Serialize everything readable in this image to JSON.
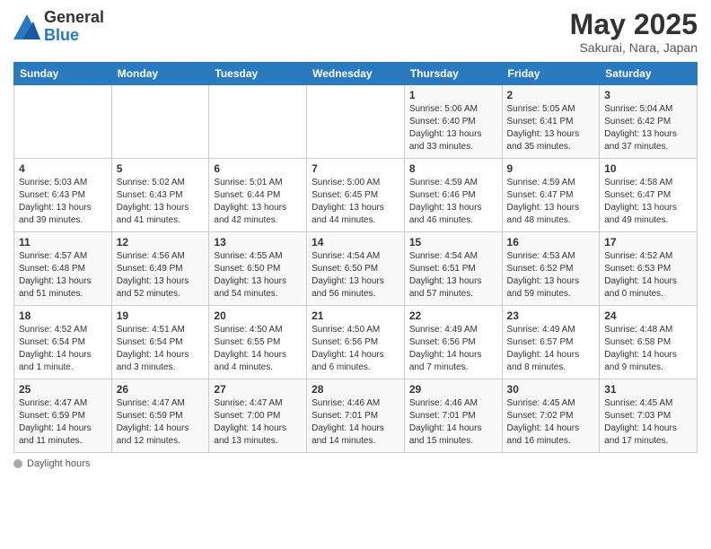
{
  "header": {
    "logo_general": "General",
    "logo_blue": "Blue",
    "month_year": "May 2025",
    "location": "Sakurai, Nara, Japan"
  },
  "weekdays": [
    "Sunday",
    "Monday",
    "Tuesday",
    "Wednesday",
    "Thursday",
    "Friday",
    "Saturday"
  ],
  "weeks": [
    [
      {
        "day": "",
        "info": ""
      },
      {
        "day": "",
        "info": ""
      },
      {
        "day": "",
        "info": ""
      },
      {
        "day": "",
        "info": ""
      },
      {
        "day": "1",
        "info": "Sunrise: 5:06 AM\nSunset: 6:40 PM\nDaylight: 13 hours\nand 33 minutes."
      },
      {
        "day": "2",
        "info": "Sunrise: 5:05 AM\nSunset: 6:41 PM\nDaylight: 13 hours\nand 35 minutes."
      },
      {
        "day": "3",
        "info": "Sunrise: 5:04 AM\nSunset: 6:42 PM\nDaylight: 13 hours\nand 37 minutes."
      }
    ],
    [
      {
        "day": "4",
        "info": "Sunrise: 5:03 AM\nSunset: 6:43 PM\nDaylight: 13 hours\nand 39 minutes."
      },
      {
        "day": "5",
        "info": "Sunrise: 5:02 AM\nSunset: 6:43 PM\nDaylight: 13 hours\nand 41 minutes."
      },
      {
        "day": "6",
        "info": "Sunrise: 5:01 AM\nSunset: 6:44 PM\nDaylight: 13 hours\nand 42 minutes."
      },
      {
        "day": "7",
        "info": "Sunrise: 5:00 AM\nSunset: 6:45 PM\nDaylight: 13 hours\nand 44 minutes."
      },
      {
        "day": "8",
        "info": "Sunrise: 4:59 AM\nSunset: 6:46 PM\nDaylight: 13 hours\nand 46 minutes."
      },
      {
        "day": "9",
        "info": "Sunrise: 4:59 AM\nSunset: 6:47 PM\nDaylight: 13 hours\nand 48 minutes."
      },
      {
        "day": "10",
        "info": "Sunrise: 4:58 AM\nSunset: 6:47 PM\nDaylight: 13 hours\nand 49 minutes."
      }
    ],
    [
      {
        "day": "11",
        "info": "Sunrise: 4:57 AM\nSunset: 6:48 PM\nDaylight: 13 hours\nand 51 minutes."
      },
      {
        "day": "12",
        "info": "Sunrise: 4:56 AM\nSunset: 6:49 PM\nDaylight: 13 hours\nand 52 minutes."
      },
      {
        "day": "13",
        "info": "Sunrise: 4:55 AM\nSunset: 6:50 PM\nDaylight: 13 hours\nand 54 minutes."
      },
      {
        "day": "14",
        "info": "Sunrise: 4:54 AM\nSunset: 6:50 PM\nDaylight: 13 hours\nand 56 minutes."
      },
      {
        "day": "15",
        "info": "Sunrise: 4:54 AM\nSunset: 6:51 PM\nDaylight: 13 hours\nand 57 minutes."
      },
      {
        "day": "16",
        "info": "Sunrise: 4:53 AM\nSunset: 6:52 PM\nDaylight: 13 hours\nand 59 minutes."
      },
      {
        "day": "17",
        "info": "Sunrise: 4:52 AM\nSunset: 6:53 PM\nDaylight: 14 hours\nand 0 minutes."
      }
    ],
    [
      {
        "day": "18",
        "info": "Sunrise: 4:52 AM\nSunset: 6:54 PM\nDaylight: 14 hours\nand 1 minute."
      },
      {
        "day": "19",
        "info": "Sunrise: 4:51 AM\nSunset: 6:54 PM\nDaylight: 14 hours\nand 3 minutes."
      },
      {
        "day": "20",
        "info": "Sunrise: 4:50 AM\nSunset: 6:55 PM\nDaylight: 14 hours\nand 4 minutes."
      },
      {
        "day": "21",
        "info": "Sunrise: 4:50 AM\nSunset: 6:56 PM\nDaylight: 14 hours\nand 6 minutes."
      },
      {
        "day": "22",
        "info": "Sunrise: 4:49 AM\nSunset: 6:56 PM\nDaylight: 14 hours\nand 7 minutes."
      },
      {
        "day": "23",
        "info": "Sunrise: 4:49 AM\nSunset: 6:57 PM\nDaylight: 14 hours\nand 8 minutes."
      },
      {
        "day": "24",
        "info": "Sunrise: 4:48 AM\nSunset: 6:58 PM\nDaylight: 14 hours\nand 9 minutes."
      }
    ],
    [
      {
        "day": "25",
        "info": "Sunrise: 4:47 AM\nSunset: 6:59 PM\nDaylight: 14 hours\nand 11 minutes."
      },
      {
        "day": "26",
        "info": "Sunrise: 4:47 AM\nSunset: 6:59 PM\nDaylight: 14 hours\nand 12 minutes."
      },
      {
        "day": "27",
        "info": "Sunrise: 4:47 AM\nSunset: 7:00 PM\nDaylight: 14 hours\nand 13 minutes."
      },
      {
        "day": "28",
        "info": "Sunrise: 4:46 AM\nSunset: 7:01 PM\nDaylight: 14 hours\nand 14 minutes."
      },
      {
        "day": "29",
        "info": "Sunrise: 4:46 AM\nSunset: 7:01 PM\nDaylight: 14 hours\nand 15 minutes."
      },
      {
        "day": "30",
        "info": "Sunrise: 4:45 AM\nSunset: 7:02 PM\nDaylight: 14 hours\nand 16 minutes."
      },
      {
        "day": "31",
        "info": "Sunrise: 4:45 AM\nSunset: 7:03 PM\nDaylight: 14 hours\nand 17 minutes."
      }
    ]
  ],
  "footer": {
    "daylight_label": "Daylight hours"
  }
}
